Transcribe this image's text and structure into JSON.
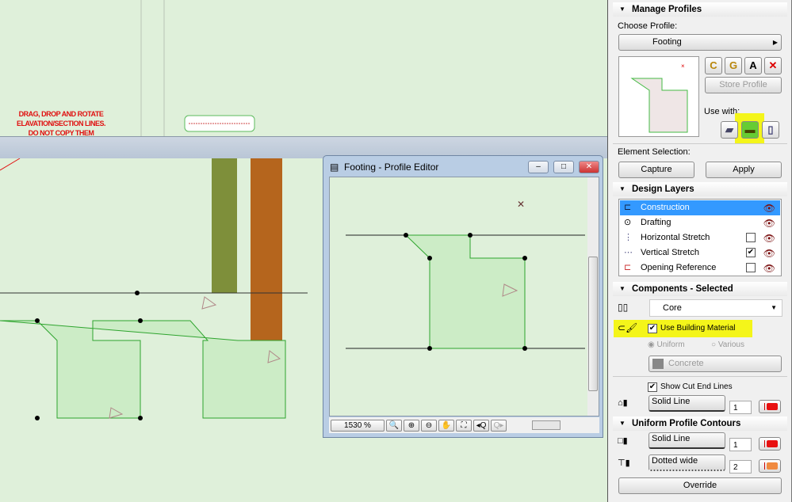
{
  "canvas": {
    "warning_text": [
      "DRAG, DROP AND ROTATE",
      "ELAVATION/SECTION LINES.",
      "DO NOT COPY THEM"
    ],
    "colors": {
      "background": "#dff0da",
      "profile_fill": "#c9efc4",
      "profile_stroke": "#2ea42e",
      "green_column": "#7e8f3a",
      "orange_column": "#b5651d"
    }
  },
  "editor": {
    "title": "Footing - Profile Editor",
    "zoom": "1530 %",
    "buttons": [
      "zoom-fit",
      "zoom-in",
      "zoom-out",
      "pan",
      "zoom-window",
      "previous-zoom",
      "next-zoom"
    ],
    "window_controls": [
      "minimize",
      "maximize",
      "close"
    ]
  },
  "panel": {
    "manage_profiles": {
      "header": "Manage Profiles",
      "choose_label": "Choose Profile:",
      "selected_profile": "Footing",
      "store_button": "Store Profile",
      "use_with_label": "Use with:",
      "use_with": [
        {
          "name": "wall",
          "active": false
        },
        {
          "name": "beam",
          "active": true
        },
        {
          "name": "column",
          "active": false
        }
      ],
      "icon_buttons": [
        "new-profile",
        "duplicate-profile",
        "rename-profile",
        "delete-profile"
      ]
    },
    "element_selection": {
      "label": "Element Selection:",
      "capture": "Capture",
      "apply": "Apply"
    },
    "design_layers": {
      "header": "Design Layers",
      "items": [
        {
          "label": "Construction",
          "checkbox": null,
          "visible": true,
          "selected": true
        },
        {
          "label": "Drafting",
          "checkbox": null,
          "visible": true,
          "selected": false
        },
        {
          "label": "Horizontal Stretch",
          "checkbox": false,
          "visible": true,
          "selected": false
        },
        {
          "label": "Vertical Stretch",
          "checkbox": true,
          "visible": true,
          "selected": false
        },
        {
          "label": "Opening Reference",
          "checkbox": false,
          "visible": true,
          "selected": false
        }
      ]
    },
    "components": {
      "header": "Components - Selected",
      "component": "Core",
      "use_building_material": "Use Building Material",
      "use_building_material_checked": true,
      "uniform": "Uniform",
      "various": "Various",
      "material": "Concrete",
      "show_cut_end_lines": "Show Cut End Lines",
      "show_cut_end_lines_checked": true,
      "cut_end_line_type": "Solid Line",
      "cut_end_pen": "1",
      "cut_end_pen_color": "#e81010"
    },
    "contours": {
      "header": "Uniform Profile Contours",
      "rows": [
        {
          "line_type": "Solid Line",
          "pen": "1",
          "color": "#e81010"
        },
        {
          "line_type": "Dotted wide",
          "pen": "2",
          "color": "#f08a40"
        }
      ],
      "override": "Override"
    }
  }
}
